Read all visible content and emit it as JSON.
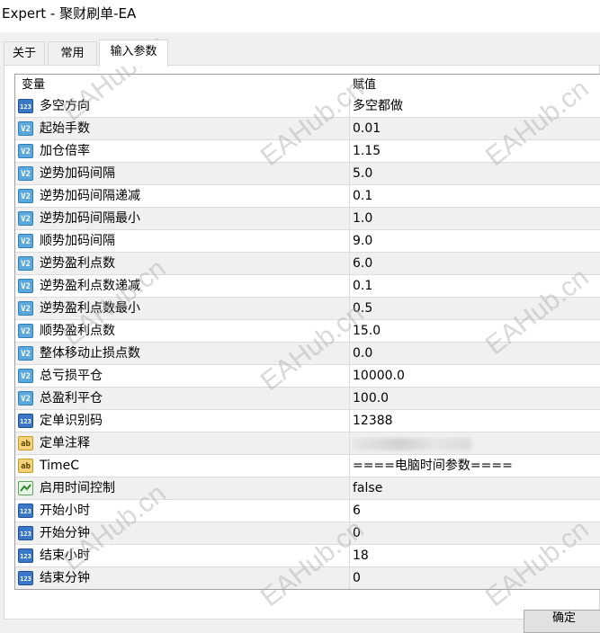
{
  "window": {
    "title": "Expert - 聚财刷单-EA"
  },
  "tabs": [
    {
      "label": "关于"
    },
    {
      "label": "常用"
    },
    {
      "label": "输入参数"
    }
  ],
  "grid": {
    "headers": {
      "variable": "变量",
      "value": "赋值"
    },
    "rows": [
      {
        "type": "int",
        "icon": "integer-icon",
        "name": "多空方向",
        "value": "多空都做"
      },
      {
        "type": "dbl",
        "icon": "double-icon",
        "name": "起始手数",
        "value": "0.01"
      },
      {
        "type": "dbl",
        "icon": "double-icon",
        "name": "加仓倍率",
        "value": "1.15"
      },
      {
        "type": "dbl",
        "icon": "double-icon",
        "name": "逆势加码间隔",
        "value": "5.0"
      },
      {
        "type": "dbl",
        "icon": "double-icon",
        "name": "逆势加码间隔递减",
        "value": "0.1"
      },
      {
        "type": "dbl",
        "icon": "double-icon",
        "name": "逆势加码间隔最小",
        "value": "1.0"
      },
      {
        "type": "dbl",
        "icon": "double-icon",
        "name": "顺势加码间隔",
        "value": "9.0"
      },
      {
        "type": "dbl",
        "icon": "double-icon",
        "name": "逆势盈利点数",
        "value": "6.0"
      },
      {
        "type": "dbl",
        "icon": "double-icon",
        "name": "逆势盈利点数递减",
        "value": "0.1"
      },
      {
        "type": "dbl",
        "icon": "double-icon",
        "name": "逆势盈利点数最小",
        "value": "0.5"
      },
      {
        "type": "dbl",
        "icon": "double-icon",
        "name": "顺势盈利点数",
        "value": "15.0"
      },
      {
        "type": "dbl",
        "icon": "double-icon",
        "name": "整体移动止损点数",
        "value": "0.0"
      },
      {
        "type": "dbl",
        "icon": "double-icon",
        "name": "总亏损平仓",
        "value": "10000.0"
      },
      {
        "type": "dbl",
        "icon": "double-icon",
        "name": "总盈利平仓",
        "value": "100.0"
      },
      {
        "type": "int",
        "icon": "integer-icon",
        "name": "定单识别码",
        "value": "12388"
      },
      {
        "type": "str",
        "icon": "string-icon",
        "name": "定单注释",
        "value": ""
      },
      {
        "type": "str",
        "icon": "string-icon",
        "name": "TimeC",
        "value": "====电脑时间参数===="
      },
      {
        "type": "bool",
        "icon": "boolean-icon",
        "name": "启用时间控制",
        "value": "false"
      },
      {
        "type": "int",
        "icon": "integer-icon",
        "name": "开始小时",
        "value": "6"
      },
      {
        "type": "int",
        "icon": "integer-icon",
        "name": "开始分钟",
        "value": "0"
      },
      {
        "type": "int",
        "icon": "integer-icon",
        "name": "结束小时",
        "value": "18"
      },
      {
        "type": "int",
        "icon": "integer-icon",
        "name": "结束分钟",
        "value": "0"
      }
    ]
  },
  "watermark": "EAHub.cn",
  "footer": {
    "ok_label": "确定"
  }
}
